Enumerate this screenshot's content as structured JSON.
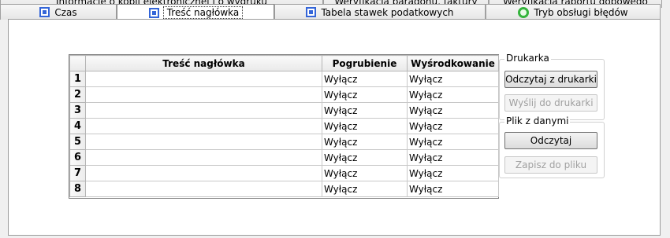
{
  "tabs_top": [
    {
      "label": "Informacje o kopii elektronicznej i o wydruku"
    },
    {
      "label": "Weryfikacja paragonu, faktury"
    },
    {
      "label": "Weryfikacja raportu dobowego"
    }
  ],
  "tabs_bottom": [
    {
      "label": "Czas",
      "icon": "square-icon"
    },
    {
      "label": "Treść nagłówka",
      "icon": "square-icon",
      "selected": true
    },
    {
      "label": "Tabela stawek podatkowych",
      "icon": "square-icon"
    },
    {
      "label": "Tryb obsługi błędów",
      "icon": "circle-icon"
    }
  ],
  "table": {
    "headers": [
      "Treść nagłówka",
      "Pogrubienie",
      "Wyśrodkowanie"
    ],
    "rows": [
      {
        "num": "1",
        "text": "",
        "bold": "Wyłącz",
        "center": "Wyłącz"
      },
      {
        "num": "2",
        "text": "",
        "bold": "Wyłącz",
        "center": "Wyłącz"
      },
      {
        "num": "3",
        "text": "",
        "bold": "Wyłącz",
        "center": "Wyłącz"
      },
      {
        "num": "4",
        "text": "",
        "bold": "Wyłącz",
        "center": "Wyłącz"
      },
      {
        "num": "5",
        "text": "",
        "bold": "Wyłącz",
        "center": "Wyłącz"
      },
      {
        "num": "6",
        "text": "",
        "bold": "Wyłącz",
        "center": "Wyłącz"
      },
      {
        "num": "7",
        "text": "",
        "bold": "Wyłącz",
        "center": "Wyłącz"
      },
      {
        "num": "8",
        "text": "",
        "bold": "Wyłącz",
        "center": "Wyłącz"
      }
    ]
  },
  "printer_group": {
    "title": "Drukarka",
    "read_button": "Odczytaj z drukarki",
    "send_button": "Wyślij do drukarki"
  },
  "file_group": {
    "title": "Plik z danymi",
    "read_button": "Odczytaj",
    "save_button": "Zapisz do pliku"
  },
  "colors": {
    "square_icon": "#3465d8",
    "circle_icon": "#35b43d"
  }
}
